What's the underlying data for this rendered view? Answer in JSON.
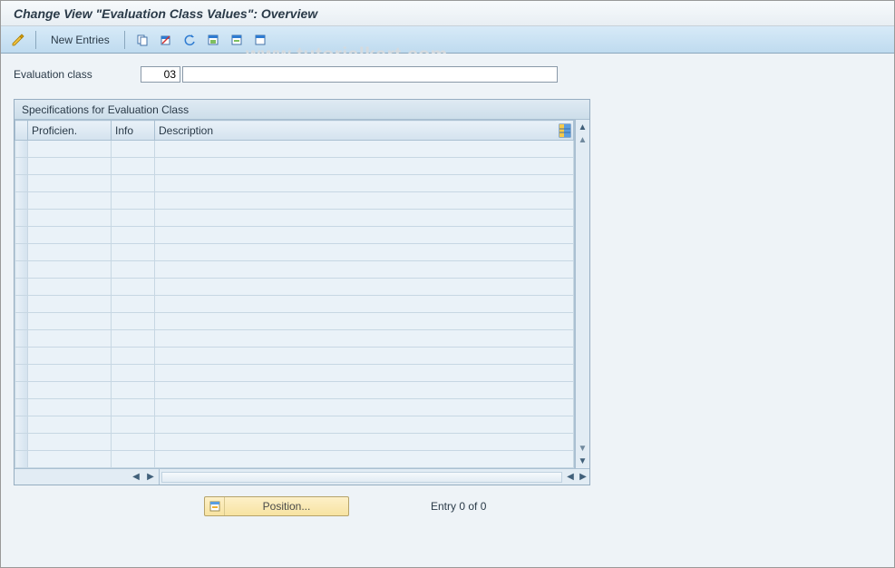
{
  "header": {
    "title": "Change View \"Evaluation Class Values\": Overview"
  },
  "toolbar": {
    "new_entries_label": "New Entries"
  },
  "watermark": "www.tutorialkart.com",
  "field": {
    "label": "Evaluation class",
    "value_small": "03",
    "value_wide": ""
  },
  "panel": {
    "title": "Specifications for Evaluation Class",
    "columns": {
      "proficiency": "Proficien.",
      "info": "Info",
      "description": "Description"
    },
    "row_count": 19
  },
  "footer": {
    "position_label": "Position...",
    "entry_text": "Entry 0 of 0"
  }
}
